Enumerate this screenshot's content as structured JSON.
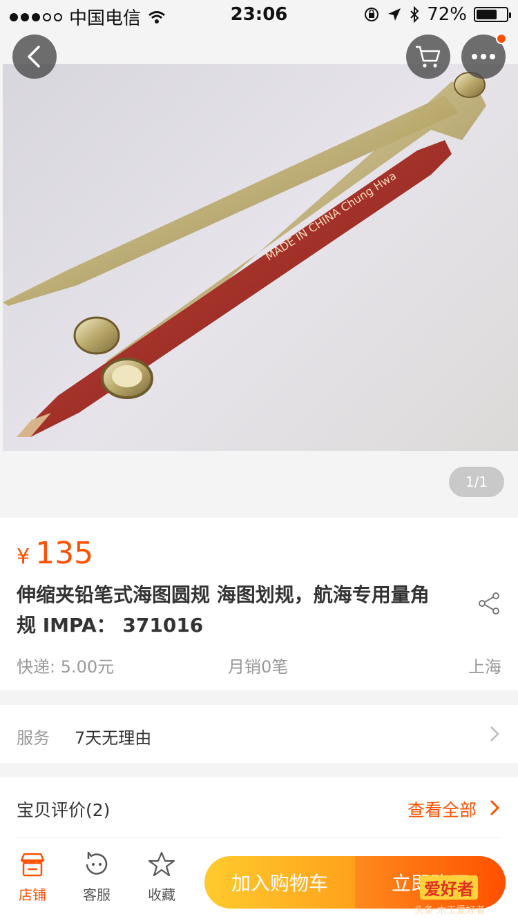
{
  "status_bar": {
    "carrier": "中国电信",
    "time": "23:06",
    "battery": "72%",
    "battery_level": 0.72
  },
  "gallery": {
    "photo_text": "MADE IN CHINA Chung Hwa",
    "page_indicator": "1/1"
  },
  "product": {
    "currency": "¥",
    "price": "135",
    "title": "伸缩夹铅笔式海图圆规 海图划规，航海专用量角规  IMPA：  371016",
    "shipping": "快递: 5.00元",
    "sales": "月销0笔",
    "location": "上海"
  },
  "service": {
    "label": "服务",
    "value": "7天无理由"
  },
  "reviews": {
    "label": "宝贝评价(2)",
    "view_all": "查看全部"
  },
  "bottom_bar": {
    "shop": "店铺",
    "customer_service": "客服",
    "favorite": "收藏",
    "add_to_cart": "加入购物车",
    "buy_now": "立即购买"
  },
  "watermark": {
    "logo_text": "爱好者",
    "caption": "头条 木工爱好者"
  },
  "colors": {
    "accent": "#ff5000",
    "cart_button": "#ffa11a",
    "buy_button": "#ff5000"
  }
}
